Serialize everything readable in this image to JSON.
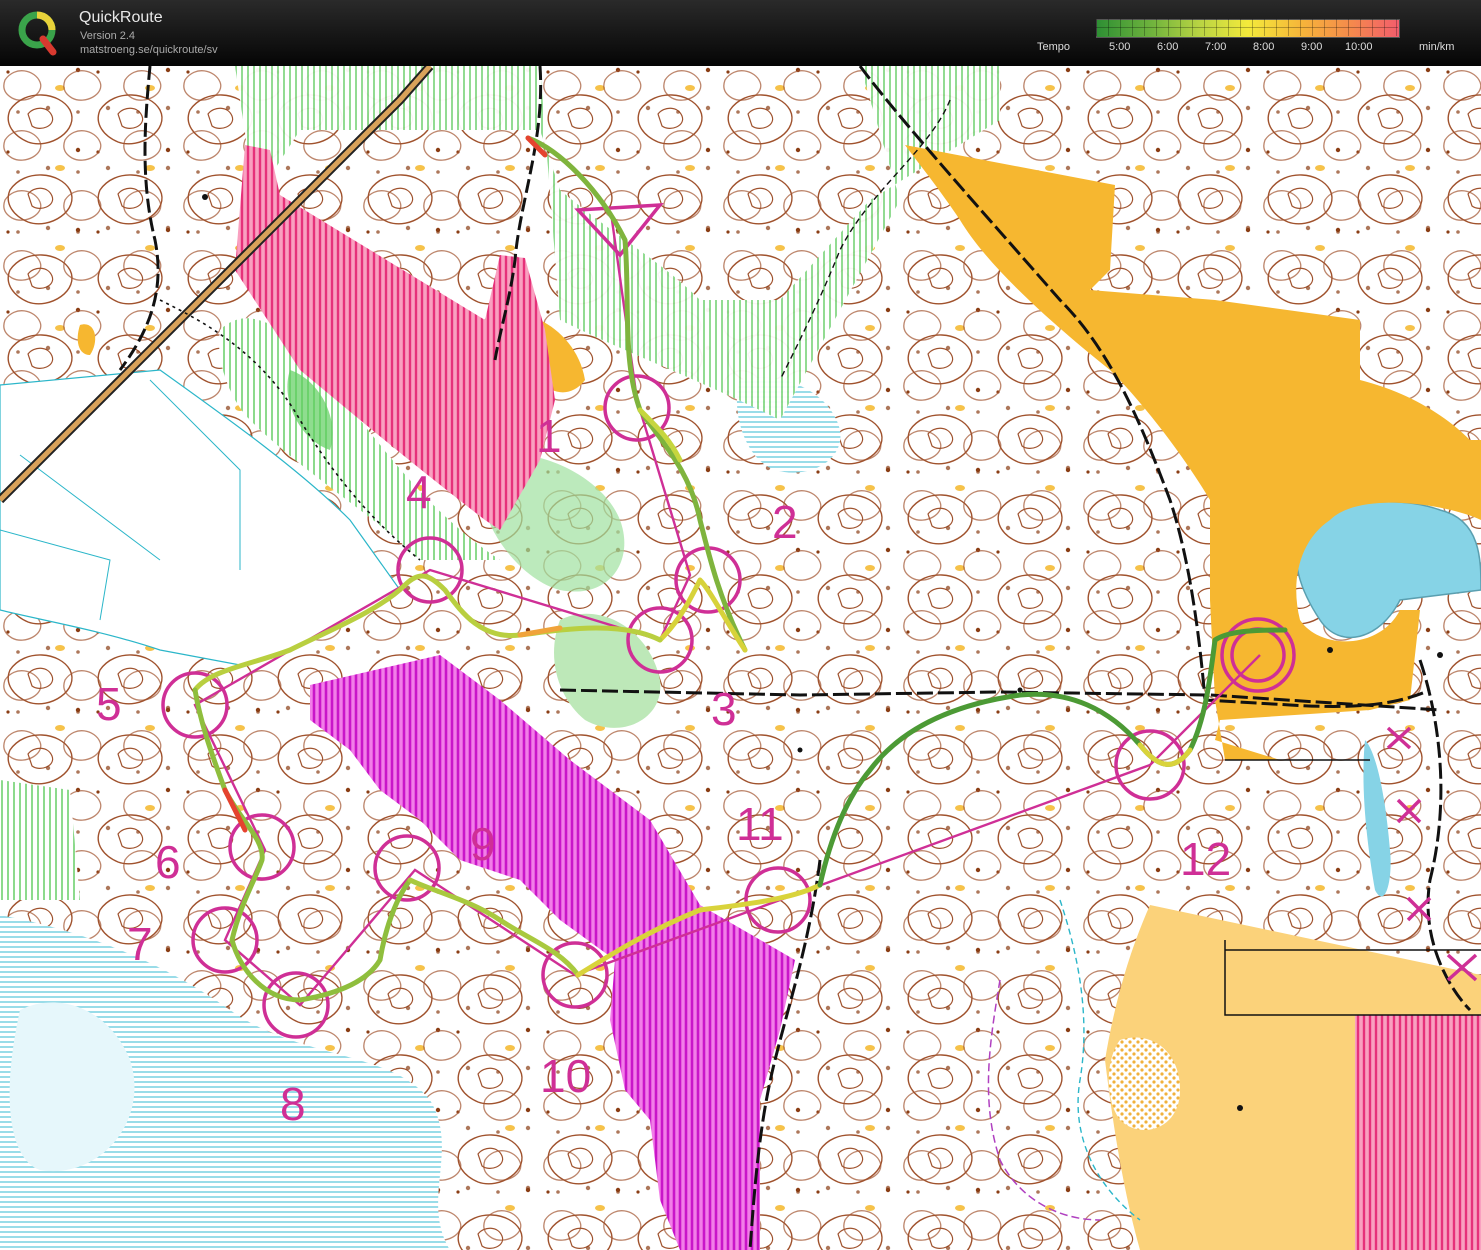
{
  "header": {
    "title": "QuickRoute",
    "version": "Version 2.4",
    "url": "matstroeng.se/quickroute/sv",
    "legend": {
      "label": "Tempo",
      "ticks": [
        "5:00",
        "6:00",
        "7:00",
        "8:00",
        "9:00",
        "10:00"
      ],
      "unit": "min/km"
    }
  },
  "map": {
    "controls": [
      {
        "label": "1"
      },
      {
        "label": "2"
      },
      {
        "label": "3"
      },
      {
        "label": "4"
      },
      {
        "label": "5"
      },
      {
        "label": "6"
      },
      {
        "label": "7"
      },
      {
        "label": "8"
      },
      {
        "label": "9"
      },
      {
        "label": "10"
      },
      {
        "label": "11"
      },
      {
        "label": "12"
      }
    ]
  },
  "colors": {
    "course": "#cf2f96",
    "contour": "#8a3d14",
    "open_land": "#f6b730",
    "water": "#86d3e6",
    "vegetation": "#5fcf5f",
    "out_of_bounds": "#e8469a"
  }
}
